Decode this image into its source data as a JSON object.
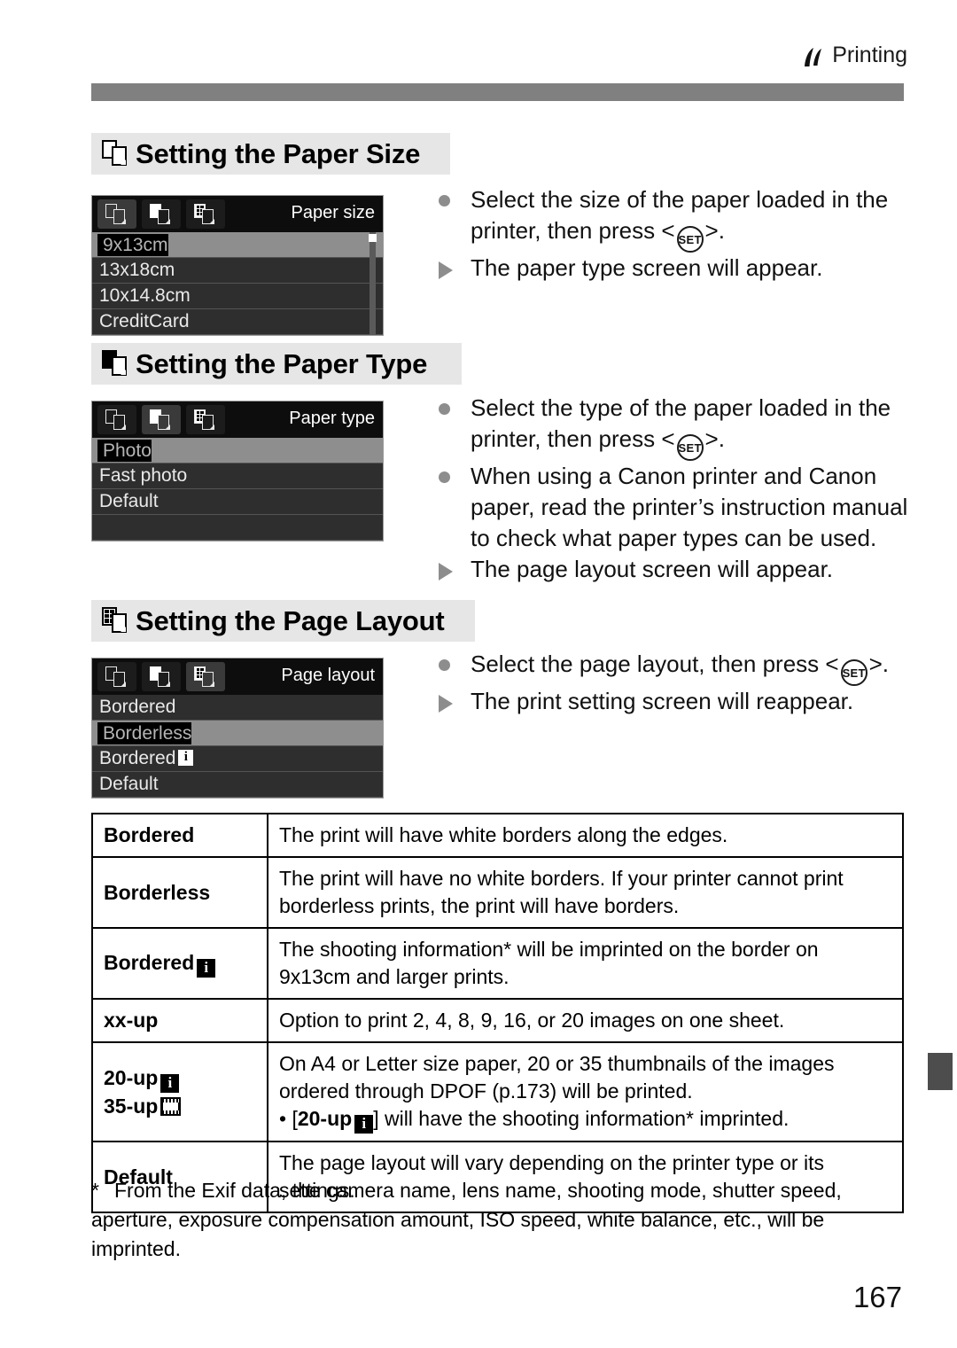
{
  "header": {
    "chapter_label": "Printing",
    "chapter_icon": "printing-icon"
  },
  "sections": [
    {
      "id": "paper-size",
      "title": "Setting the Paper Size",
      "icon": "paper-size-icon",
      "screen": {
        "title": "Paper size",
        "active_tab": 0,
        "tabs": [
          "paper-size-tab-icon",
          "paper-type-tab-icon",
          "page-layout-tab-icon"
        ],
        "rows": [
          {
            "label": "9x13cm",
            "selected": true
          },
          {
            "label": "13x18cm",
            "selected": false
          },
          {
            "label": "10x14.8cm",
            "selected": false
          },
          {
            "label": "CreditCard",
            "selected": false
          }
        ],
        "scrollbar": true
      },
      "instructions": [
        {
          "marker": "dot",
          "text_parts": [
            "Select the size of the paper loaded in the printer, then press <",
            "SET",
            ">."
          ]
        },
        {
          "marker": "triangle",
          "text_parts": [
            "The paper type screen will appear."
          ]
        }
      ]
    },
    {
      "id": "paper-type",
      "title": "Setting the Paper Type",
      "icon": "paper-type-icon",
      "screen": {
        "title": "Paper type",
        "active_tab": 1,
        "tabs": [
          "paper-size-tab-icon",
          "paper-type-tab-icon",
          "page-layout-tab-icon"
        ],
        "rows": [
          {
            "label": "Photo",
            "selected": true
          },
          {
            "label": "Fast photo",
            "selected": false
          },
          {
            "label": "Default",
            "selected": false
          },
          {
            "label": "",
            "selected": false
          }
        ],
        "scrollbar": false
      },
      "instructions": [
        {
          "marker": "dot",
          "text_parts": [
            "Select the type of the paper loaded in the printer, then press <",
            "SET",
            ">."
          ]
        },
        {
          "marker": "dot",
          "text_parts": [
            "When using a Canon printer and Canon paper, read the printer’s instruction manual to check what paper types can be used."
          ]
        },
        {
          "marker": "triangle",
          "text_parts": [
            "The page layout screen will appear."
          ]
        }
      ]
    },
    {
      "id": "page-layout",
      "title": "Setting the Page Layout",
      "icon": "page-layout-icon",
      "screen": {
        "title": "Page layout",
        "active_tab": 2,
        "tabs": [
          "paper-size-tab-icon",
          "paper-type-tab-icon",
          "page-layout-tab-icon"
        ],
        "rows": [
          {
            "label": "Bordered",
            "selected": false
          },
          {
            "label": "Borderless",
            "selected": true
          },
          {
            "label": "Bordered",
            "selected": false,
            "badge": "info"
          },
          {
            "label": "Default",
            "selected": false
          }
        ],
        "scrollbar": false
      },
      "instructions": [
        {
          "marker": "dot",
          "text_parts": [
            "Select the page layout, then press <",
            "SET",
            ">."
          ]
        },
        {
          "marker": "triangle",
          "text_parts": [
            "The print setting screen will reappear."
          ]
        }
      ]
    }
  ],
  "table": {
    "rows": [
      {
        "term": "Bordered",
        "term_badge": "",
        "desc": "The print will have white borders along the edges."
      },
      {
        "term": "Borderless",
        "term_badge": "",
        "desc": "The print will have no white borders. If your printer cannot print borderless prints, the print will have borders."
      },
      {
        "term": "Bordered",
        "term_badge": "info",
        "desc": "The shooting information* will be imprinted on the border on 9x13cm and larger prints."
      },
      {
        "term": "xx-up",
        "term_badge": "",
        "desc": "Option to print 2, 4, 8, 9, 16, or 20 images on one sheet."
      },
      {
        "term": "20-up",
        "term_badge": "info",
        "term2": "35-up",
        "term2_badge": "film",
        "desc_line1": "On A4 or Letter size paper, 20 or 35 thumbnails of the images ordered through DPOF (p.173) will be printed.",
        "desc_line2_prefix": "• [",
        "desc_line2_bold": "20-up",
        "desc_line2_badge": "info",
        "desc_line2_suffix": "] will have the shooting information* imprinted."
      },
      {
        "term": "Default",
        "term_badge": "",
        "desc": "The page layout will vary depending on the printer type or its settings."
      }
    ]
  },
  "footnote": {
    "marker": "*",
    "text": "From the Exif data, the camera name, lens name, shooting mode, shutter speed, aperture, exposure compensation amount, ISO speed, white balance, etc., will be imprinted."
  },
  "page_number": "167",
  "colors": {
    "header_rule": "#808080",
    "heading_band": "#e6e6e6",
    "lcd_background": "#2b2b2b",
    "lcd_selected": "#8e8e8e",
    "side_tab": "#4d4d4d"
  }
}
